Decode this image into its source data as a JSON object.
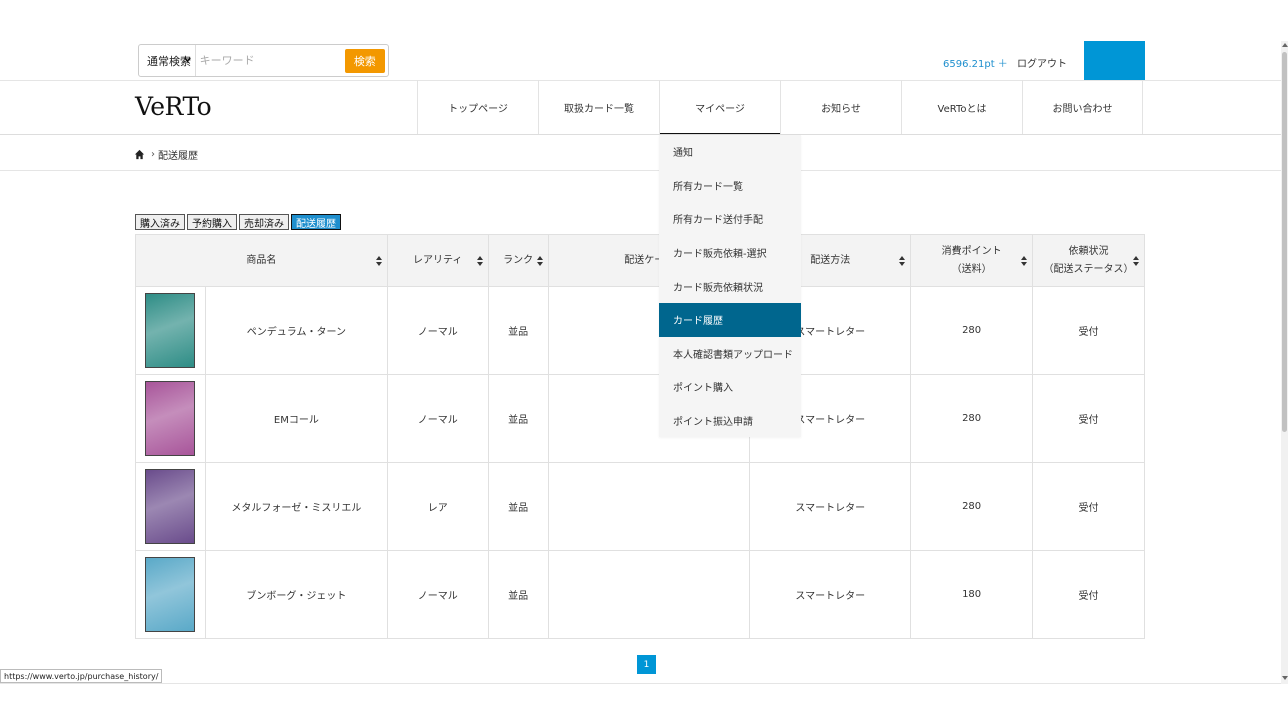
{
  "search": {
    "mode_selected": "通常検索",
    "placeholder": "キーワード",
    "button_label": "検索"
  },
  "account": {
    "points": "6596.21pt ＋",
    "logout_label": "ログアウト"
  },
  "logo": "VeRTo",
  "nav": [
    {
      "label": "トップページ"
    },
    {
      "label": "取扱カード一覧"
    },
    {
      "label": "マイページ"
    },
    {
      "label": "お知らせ"
    },
    {
      "label": "VeRToとは"
    },
    {
      "label": "お問い合わせ"
    }
  ],
  "breadcrumb": {
    "current": "配送履歴"
  },
  "tabs": [
    {
      "label": "購入済み"
    },
    {
      "label": "予約購入"
    },
    {
      "label": "売却済み"
    },
    {
      "label": "配送履歴"
    }
  ],
  "table": {
    "headers": {
      "name": "商品名",
      "rarity": "レアリティ",
      "rank": "ランク",
      "case": "配送ケース",
      "method": "配送方法",
      "points_line1": "消費ポイント",
      "points_line2": "（送料）",
      "status_line1": "依頼状況",
      "status_line2": "（配送ステータス）"
    },
    "rows": [
      {
        "name": "ペンデュラム・ターン",
        "rarity": "ノーマル",
        "rank": "並品",
        "case": "",
        "method": "スマートレター",
        "points": "280",
        "status": "受付",
        "card_color": "#2e8d86"
      },
      {
        "name": "EMコール",
        "rarity": "ノーマル",
        "rank": "並品",
        "case": "",
        "method": "スマートレター",
        "points": "280",
        "status": "受付",
        "card_color": "#a8559a"
      },
      {
        "name": "メタルフォーゼ・ミスリエル",
        "rarity": "レア",
        "rank": "並品",
        "case": "",
        "method": "スマートレター",
        "points": "280",
        "status": "受付",
        "card_color": "#6a4c8c"
      },
      {
        "name": "ブンボーグ・ジェット",
        "rarity": "ノーマル",
        "rank": "並品",
        "case": "",
        "method": "スマートレター",
        "points": "180",
        "status": "受付",
        "card_color": "#5aa9c8"
      }
    ]
  },
  "dropdown": [
    {
      "label": "通知"
    },
    {
      "label": "所有カード一覧"
    },
    {
      "label": "所有カード送付手配"
    },
    {
      "label": "カード販売依頼-選択"
    },
    {
      "label": "カード販売依頼状況"
    },
    {
      "label": "カード履歴"
    },
    {
      "label": "本人確認書類アップロード"
    },
    {
      "label": "ポイント購入"
    },
    {
      "label": "ポイント振込申請"
    }
  ],
  "pagination": {
    "current": "1"
  },
  "status_url": "https://www.verto.jp/purchase_history/",
  "colors": {
    "accent": "#0096d6",
    "search_button": "#f39800",
    "dropdown_active": "#00668e"
  }
}
